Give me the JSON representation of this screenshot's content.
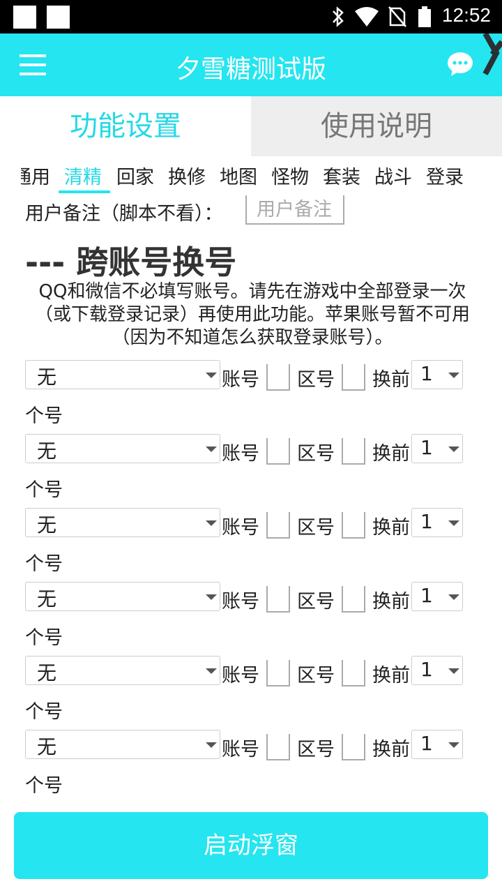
{
  "status_bar": {
    "time": "12:52"
  },
  "app_bar": {
    "title": "夕雪糖测试版"
  },
  "tabs": [
    {
      "label": "功能设置",
      "active": true
    },
    {
      "label": "使用说明",
      "active": false
    }
  ],
  "subnav": {
    "items": [
      "通用",
      "清精",
      "回家",
      "换修",
      "地图",
      "怪物",
      "套装",
      "战斗",
      "登录"
    ],
    "active_index": 1
  },
  "remark": {
    "label": "用户备注（脚本不看）：",
    "placeholder": "用户备注"
  },
  "section": {
    "heading": "--- 跨账号换号",
    "description": "QQ和微信不必填写账号。请先在游戏中全部登录一次（或下载登录记录）再使用此功能。苹果账号暂不可用（因为不知道怎么获取登录账号）。"
  },
  "rows": [
    {
      "account_select": "无",
      "account_label": "账号",
      "zone_label": "区号",
      "before_label": "换前",
      "count_select": "1",
      "tail": "个号"
    },
    {
      "account_select": "无",
      "account_label": "账号",
      "zone_label": "区号",
      "before_label": "换前",
      "count_select": "1",
      "tail": "个号"
    },
    {
      "account_select": "无",
      "account_label": "账号",
      "zone_label": "区号",
      "before_label": "换前",
      "count_select": "1",
      "tail": "个号"
    },
    {
      "account_select": "无",
      "account_label": "账号",
      "zone_label": "区号",
      "before_label": "换前",
      "count_select": "1",
      "tail": "个号"
    },
    {
      "account_select": "无",
      "account_label": "账号",
      "zone_label": "区号",
      "before_label": "换前",
      "count_select": "1",
      "tail": "个号"
    },
    {
      "account_select": "无",
      "account_label": "账号",
      "zone_label": "区号",
      "before_label": "换前",
      "count_select": "1",
      "tail": "个号"
    }
  ],
  "start_button": {
    "label": "启动浮窗"
  },
  "colors": {
    "accent": "#24e5f0",
    "accent_text": "#24d9e6"
  }
}
